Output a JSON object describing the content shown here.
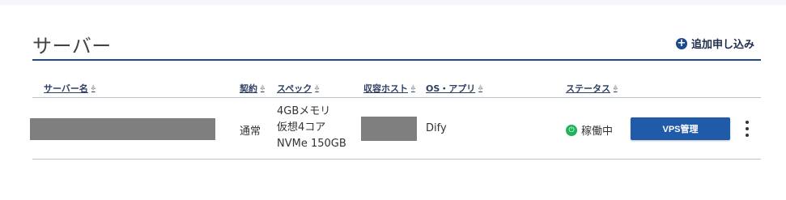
{
  "page": {
    "title": "サーバー",
    "add_label": "追加申し込み",
    "colors": {
      "accent": "#1c4a8a",
      "button": "#1f5ba8",
      "status_ok": "#1fb35a"
    }
  },
  "table": {
    "headers": {
      "server_name": "サーバー名",
      "contract": "契約",
      "spec": "スペック",
      "host": "収容ホスト",
      "os_app": "OS・アプリ",
      "status": "ステータス"
    },
    "rows": [
      {
        "contract": "通常",
        "spec": [
          "4GBメモリ",
          "仮想4コア",
          "NVMe 150GB"
        ],
        "os_app": "Dify",
        "status": "稼働中",
        "status_icon": "power-icon",
        "action_label": "VPS管理"
      }
    ]
  }
}
